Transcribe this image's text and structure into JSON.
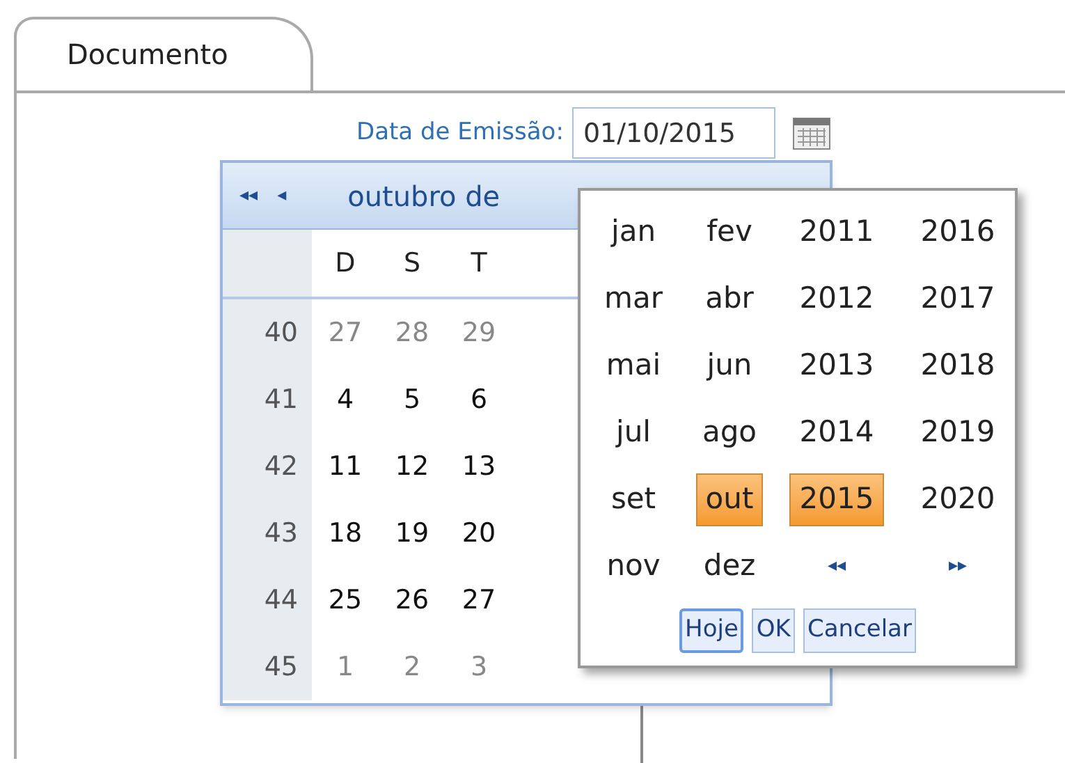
{
  "tabs": [
    {
      "label": "Documento",
      "selected": true
    }
  ],
  "form": {
    "label": "Data de Emissão:",
    "value": "01/10/2015"
  },
  "calendar": {
    "prev_year": "◂◂",
    "prev_month": "◂",
    "title": "outubro de",
    "weekdays": [
      "D",
      "S",
      "T"
    ],
    "weeks": [
      {
        "number": "40",
        "days": [
          {
            "text": "27",
            "other_month": true
          },
          {
            "text": "28",
            "other_month": true
          },
          {
            "text": "29",
            "other_month": true
          }
        ]
      },
      {
        "number": "41",
        "days": [
          {
            "text": "4",
            "other_month": false
          },
          {
            "text": "5",
            "other_month": false
          },
          {
            "text": "6",
            "other_month": false
          }
        ]
      },
      {
        "number": "42",
        "days": [
          {
            "text": "11",
            "other_month": false
          },
          {
            "text": "12",
            "other_month": false
          },
          {
            "text": "13",
            "other_month": false
          }
        ]
      },
      {
        "number": "43",
        "days": [
          {
            "text": "18",
            "other_month": false
          },
          {
            "text": "19",
            "other_month": false
          },
          {
            "text": "20",
            "other_month": false
          }
        ]
      },
      {
        "number": "44",
        "days": [
          {
            "text": "25",
            "other_month": false
          },
          {
            "text": "26",
            "other_month": false
          },
          {
            "text": "27",
            "other_month": false
          }
        ]
      },
      {
        "number": "45",
        "days": [
          {
            "text": "1",
            "other_month": true
          },
          {
            "text": "2",
            "other_month": true
          },
          {
            "text": "3",
            "other_month": true
          }
        ]
      }
    ]
  },
  "picker": {
    "months": [
      {
        "label": "jan",
        "selected": false
      },
      {
        "label": "fev",
        "selected": false
      },
      {
        "label": "mar",
        "selected": false
      },
      {
        "label": "abr",
        "selected": false
      },
      {
        "label": "mai",
        "selected": false
      },
      {
        "label": "jun",
        "selected": false
      },
      {
        "label": "jul",
        "selected": false
      },
      {
        "label": "ago",
        "selected": false
      },
      {
        "label": "set",
        "selected": false
      },
      {
        "label": "out",
        "selected": true
      },
      {
        "label": "nov",
        "selected": false
      },
      {
        "label": "dez",
        "selected": false
      }
    ],
    "years": [
      {
        "label": "2011",
        "selected": false
      },
      {
        "label": "2012",
        "selected": false
      },
      {
        "label": "2013",
        "selected": false
      },
      {
        "label": "2014",
        "selected": false
      },
      {
        "label": "2015",
        "selected": true
      },
      {
        "label": "2016",
        "selected": false
      },
      {
        "label": "2017",
        "selected": false
      },
      {
        "label": "2018",
        "selected": false
      },
      {
        "label": "2019",
        "selected": false
      },
      {
        "label": "2020",
        "selected": false
      }
    ],
    "prev": "◂◂",
    "next": "▸▸",
    "buttons": [
      {
        "label": "Hoje",
        "focused": true
      },
      {
        "label": "OK",
        "focused": false
      },
      {
        "label": "Cancelar",
        "focused": false
      }
    ]
  }
}
